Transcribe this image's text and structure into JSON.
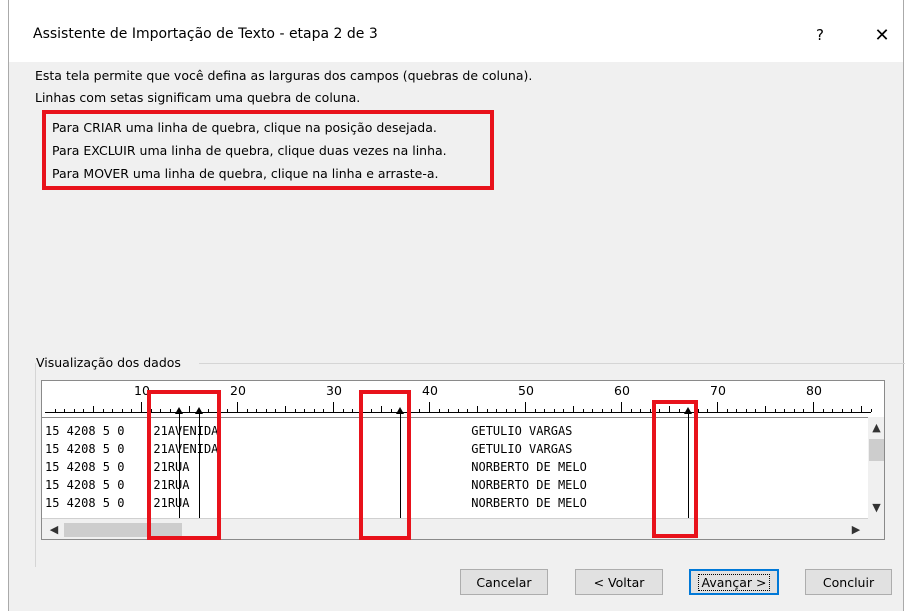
{
  "window": {
    "title": "Assistente de Importação de Texto - etapa 2 de 3",
    "help_label": "?",
    "close_label": "✕"
  },
  "description": {
    "line1": "Esta tela permite que você defina as larguras dos campos (quebras de coluna).",
    "line2": "Linhas com setas significam uma quebra de coluna."
  },
  "instructions": {
    "create": "Para CRIAR uma linha de quebra, clique na posição desejada.",
    "delete": "Para EXCLUIR uma linha de quebra, clique duas vezes na linha.",
    "move": "Para MOVER uma linha de quebra, clique na linha e arraste-a."
  },
  "preview": {
    "label": "Visualização dos dados",
    "ruler_numbers": [
      "10",
      "20",
      "30",
      "40",
      "50",
      "60",
      "70",
      "80"
    ],
    "rows": [
      "15 4208 5 0    21AVENIDA                                   GETULIO VARGAS",
      "15 4208 5 0    21AVENIDA                                   GETULIO VARGAS",
      "15 4208 5 0    21RUA                                       NORBERTO DE MELO",
      "15 4208 5 0    21RUA                                       NORBERTO DE MELO",
      "15 4208 5 0    21RUA                                       NORBERTO DE MELO"
    ],
    "column_breaks": [
      14,
      16,
      37,
      67
    ]
  },
  "buttons": {
    "cancel": "Cancelar",
    "back": "< Voltar",
    "next": "Avançar >",
    "finish": "Concluir"
  },
  "colors": {
    "highlight": "#e8121b",
    "default_button_border": "#0078d7"
  }
}
